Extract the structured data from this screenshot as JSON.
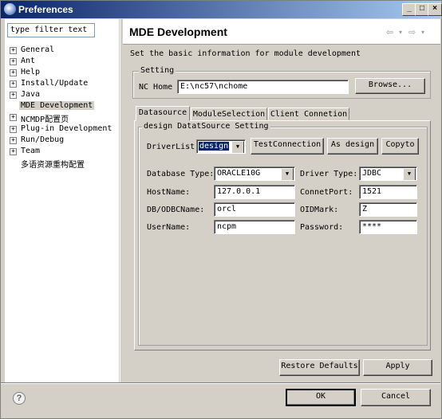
{
  "window": {
    "title": "Preferences"
  },
  "filter": {
    "value": "type filter text"
  },
  "tree": {
    "items": [
      {
        "label": "General",
        "expandable": true
      },
      {
        "label": "Ant",
        "expandable": true
      },
      {
        "label": "Help",
        "expandable": true
      },
      {
        "label": "Install/Update",
        "expandable": true
      },
      {
        "label": "Java",
        "expandable": true
      },
      {
        "label": "MDE Development",
        "expandable": false,
        "selected": true
      },
      {
        "label": "NCMDP配置页",
        "expandable": true
      },
      {
        "label": "Plug-in Development",
        "expandable": true
      },
      {
        "label": "Run/Debug",
        "expandable": true
      },
      {
        "label": "Team",
        "expandable": true
      },
      {
        "label": "多语资源重构配置",
        "expandable": false
      }
    ]
  },
  "page": {
    "title": "MDE Development",
    "description": "Set the basic information for module development"
  },
  "setting": {
    "group_label": "Setting",
    "nc_home_label": "NC Home",
    "nc_home_value": "E:\\nc57\\nchome",
    "browse_label": "Browse..."
  },
  "tabs": [
    {
      "label": "Datasource",
      "active": true
    },
    {
      "label": "ModuleSelection",
      "active": false
    },
    {
      "label": "Client Connetion",
      "active": false
    }
  ],
  "datasource": {
    "group_label": "design DatatSource Setting",
    "driverlist_label": "DriverList",
    "driverlist_value": "design",
    "test_connection_label": "TestConnection",
    "as_design_label": "As design",
    "copyto_label": "Copyto",
    "database_type_label": "Database Type:",
    "database_type_value": "ORACLE10G",
    "driver_type_label": "Driver Type:",
    "driver_type_value": "JDBC",
    "hostname_label": "HostName:",
    "hostname_value": "127.0.0.1",
    "connetport_label": "ConnetPort:",
    "connetport_value": "1521",
    "db_odbc_label": "DB/ODBCName:",
    "db_odbc_value": "orcl",
    "oidmark_label": "OIDMark:",
    "oidmark_value": "Z",
    "username_label": "UserName:",
    "username_value": "ncpm",
    "password_label": "Password:",
    "password_value": "****"
  },
  "actions": {
    "restore_defaults": "Restore Defaults",
    "apply": "Apply",
    "ok": "OK",
    "cancel": "Cancel"
  },
  "colors": {
    "titlebar_start": "#0a246a",
    "titlebar_end": "#a6caf0",
    "dialog_bg": "#d4d0c8",
    "selection": "#0a246a"
  }
}
